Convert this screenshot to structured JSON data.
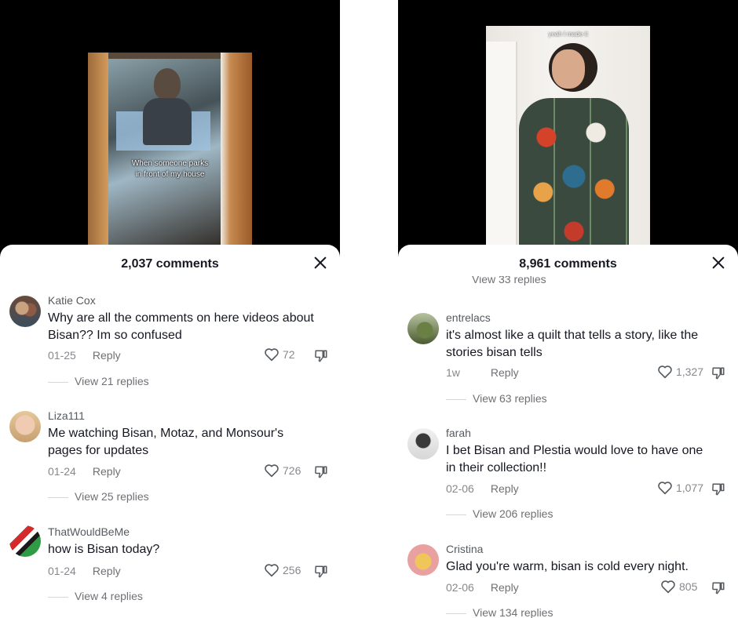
{
  "left": {
    "video_caption_line1": "When someone parks",
    "video_caption_line2": "in front of my house",
    "title": "2,037 comments",
    "comments": [
      {
        "user": "Katie Cox",
        "text": "Why are all the comments on here videos about Bisan?? Im so confused",
        "date": "01-25",
        "reply": "Reply",
        "likes": "72",
        "view_replies": "View 21 replies"
      },
      {
        "user": "Liza111",
        "text": "Me watching Bisan, Motaz, and Monsour's pages for updates",
        "date": "01-24",
        "reply": "Reply",
        "likes": "726",
        "view_replies": "View 25 replies"
      },
      {
        "user": "ThatWouldBeMe",
        "text": "how is Bisan today?",
        "date": "01-24",
        "reply": "Reply",
        "likes": "256",
        "view_replies": "View 4 replies"
      }
    ]
  },
  "right": {
    "video_caption": "yeah I made it",
    "title": "8,961 comments",
    "partial_replies": "View 33 replies",
    "comments": [
      {
        "user": "entrelacs",
        "text": "it's almost like a quilt that tells a story, like the stories bisan tells",
        "date": "1w",
        "reply": "Reply",
        "likes": "1,327",
        "view_replies": "View 63 replies"
      },
      {
        "user": "farah",
        "text": "I bet Bisan and Plestia would love to have one in their collection!!",
        "date": "02-06",
        "reply": "Reply",
        "likes": "1,077",
        "view_replies": "View 206 replies"
      },
      {
        "user": "Cristina",
        "text": "Glad you're warm, bisan is cold every night.",
        "date": "02-06",
        "reply": "Reply",
        "likes": "805",
        "view_replies": "View 134 replies"
      }
    ]
  },
  "icons": {
    "like": "heart-outline-icon",
    "dislike": "thumbs-down-icon",
    "close": "close-icon"
  }
}
